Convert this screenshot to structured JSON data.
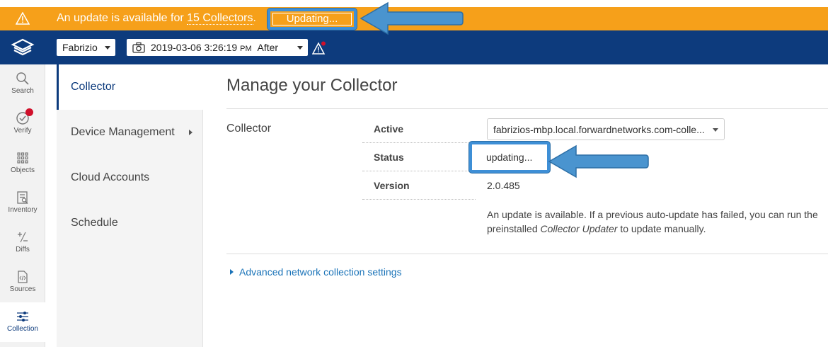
{
  "banner": {
    "message_prefix": "An update is available for ",
    "collectors_link": "15 Collectors",
    "message_suffix": ".",
    "updating_button": "Updating..."
  },
  "toolbar": {
    "user_select": "Fabrizio",
    "snapshot_datetime": "2019-03-06 3:26:19",
    "snapshot_ampm": "PM",
    "snapshot_mode": "After"
  },
  "icon_nav": [
    {
      "label": "Search",
      "icon": "search-icon"
    },
    {
      "label": "Verify",
      "icon": "verify-icon"
    },
    {
      "label": "Objects",
      "icon": "objects-grid-icon"
    },
    {
      "label": "Inventory",
      "icon": "inventory-icon"
    },
    {
      "label": "Diffs",
      "icon": "diffs-icon"
    },
    {
      "label": "Sources",
      "icon": "sources-icon"
    },
    {
      "label": "Collection",
      "icon": "collection-sliders-icon"
    }
  ],
  "sub_nav": [
    {
      "label": "Collector",
      "active": true
    },
    {
      "label": "Device Management",
      "has_submenu": true
    },
    {
      "label": "Cloud Accounts"
    },
    {
      "label": "Schedule"
    }
  ],
  "main": {
    "title": "Manage your Collector",
    "section_label": "Collector",
    "fields": {
      "active_label": "Active",
      "active_value": "fabrizios-mbp.local.forwardnetworks.com-colle...",
      "status_label": "Status",
      "status_value": "updating...",
      "version_label": "Version",
      "version_value": "2.0.485"
    },
    "help_prefix": "An update is available. If a previous auto-update has failed, you can run the preinstalled ",
    "help_emphasis": "Collector Updater",
    "help_suffix": " to update manually.",
    "advanced_link": "Advanced network collection settings"
  },
  "colors": {
    "banner": "#f6a01a",
    "toolbar": "#0d3b7d",
    "annotation_arrow": "#4a94cf",
    "link": "#1a73b8"
  }
}
